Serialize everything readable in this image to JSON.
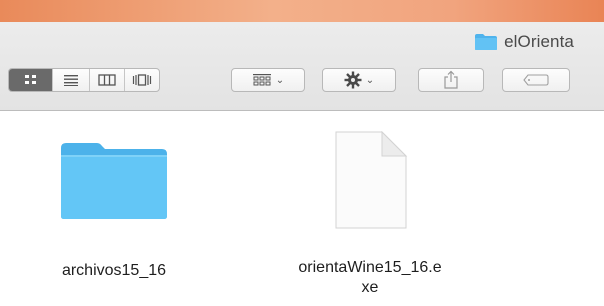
{
  "window": {
    "title": "elOrienta",
    "title_icon": "folder-icon"
  },
  "toolbar": {
    "view_buttons": [
      {
        "name": "icon-view",
        "icon": "grid-icon",
        "selected": true
      },
      {
        "name": "list-view",
        "icon": "list-icon",
        "selected": false
      },
      {
        "name": "column-view",
        "icon": "columns-icon",
        "selected": false
      },
      {
        "name": "coverflow-view",
        "icon": "coverflow-icon",
        "selected": false
      }
    ],
    "arrange_icon": "arrange-grid-icon",
    "action_icon": "gear-icon",
    "share_icon": "share-icon",
    "tag_icon": "tag-icon"
  },
  "files": [
    {
      "name": "archivos15_16",
      "kind": "folder"
    },
    {
      "name": "orientaWine15_16.e\nxe",
      "kind": "document"
    }
  ],
  "colors": {
    "folder_blue": "#5ec3f2",
    "selected_segment": "#6a6a6a",
    "accent_strip": "#f0a67e"
  }
}
